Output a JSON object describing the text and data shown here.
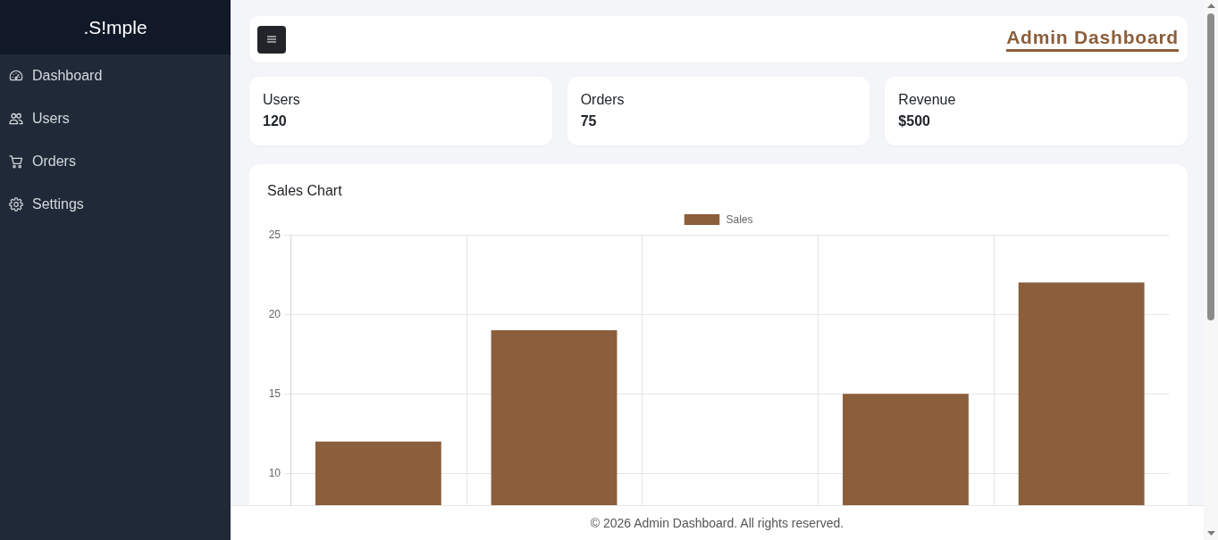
{
  "sidebar": {
    "brand": ".S!mple",
    "items": [
      {
        "label": "Dashboard"
      },
      {
        "label": "Users"
      },
      {
        "label": "Orders"
      },
      {
        "label": "Settings"
      }
    ]
  },
  "topbar": {
    "title": "Admin Dashboard"
  },
  "stats": [
    {
      "label": "Users",
      "value": "120"
    },
    {
      "label": "Orders",
      "value": "75"
    },
    {
      "label": "Revenue",
      "value": "$500"
    }
  ],
  "sales_card": {
    "title": "Sales Chart",
    "chart_data": {
      "type": "bar",
      "series": [
        {
          "name": "Sales",
          "color": "#8b5e3c",
          "values": [
            12,
            19,
            null,
            15,
            22
          ]
        }
      ],
      "ylim": [
        8,
        25
      ],
      "yticks": [
        10,
        15,
        20,
        25
      ],
      "grid": true
    }
  },
  "footer": {
    "text": "© 2026 Admin Dashboard. All rights reserved."
  }
}
